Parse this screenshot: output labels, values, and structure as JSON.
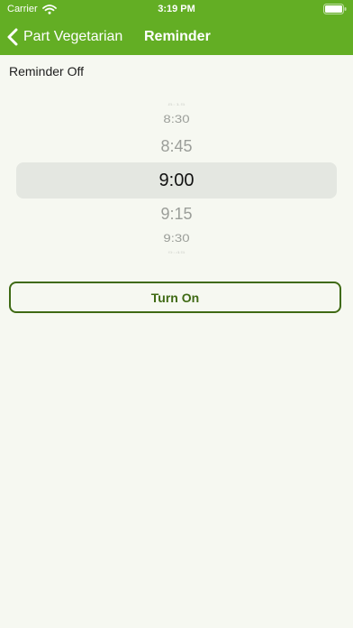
{
  "status_bar": {
    "carrier": "Carrier",
    "time": "3:19 PM",
    "icons": [
      "wifi-icon",
      "battery-icon"
    ]
  },
  "nav": {
    "back_label": "Part Vegetarian",
    "title": "Reminder",
    "back_icon": "chevron-left-icon"
  },
  "reminder": {
    "status": "Reminder Off"
  },
  "picker": {
    "options": [
      "8:15",
      "8:30",
      "8:45",
      "9:00",
      "9:15",
      "9:30",
      "9:45"
    ],
    "selected": "9:00"
  },
  "actions": {
    "turn_on_label": "Turn On"
  },
  "colors": {
    "header": "#63ae24",
    "background": "#f6f8f1",
    "accent": "#3f6a14",
    "selection": "#e4e7e1"
  }
}
